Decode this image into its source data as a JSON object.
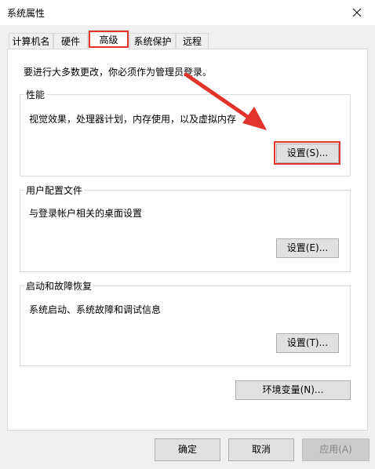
{
  "window": {
    "title": "系统属性"
  },
  "tabs": [
    {
      "label": "计算机名"
    },
    {
      "label": "硬件"
    },
    {
      "label": "高级"
    },
    {
      "label": "系统保护"
    },
    {
      "label": "远程"
    }
  ],
  "advanced": {
    "admin_note": "要进行大多数更改，你必须作为管理员登录。",
    "performance": {
      "title": "性能",
      "description": "视觉效果，处理器计划，内存使用，以及虚拟内存",
      "button": "设置(S)..."
    },
    "user_profiles": {
      "title": "用户配置文件",
      "description": "与登录帐户相关的桌面设置",
      "button": "设置(E)..."
    },
    "startup_recovery": {
      "title": "启动和故障恢复",
      "description": "系统启动、系统故障和调试信息",
      "button": "设置(T)..."
    },
    "env_button": "环境变量(N)..."
  },
  "footer": {
    "ok": "确定",
    "cancel": "取消",
    "apply": "应用(A)"
  },
  "colors": {
    "highlight": "#e2342c"
  },
  "icons": {
    "close": "close-icon",
    "annotation": "red-arrow-icon"
  }
}
